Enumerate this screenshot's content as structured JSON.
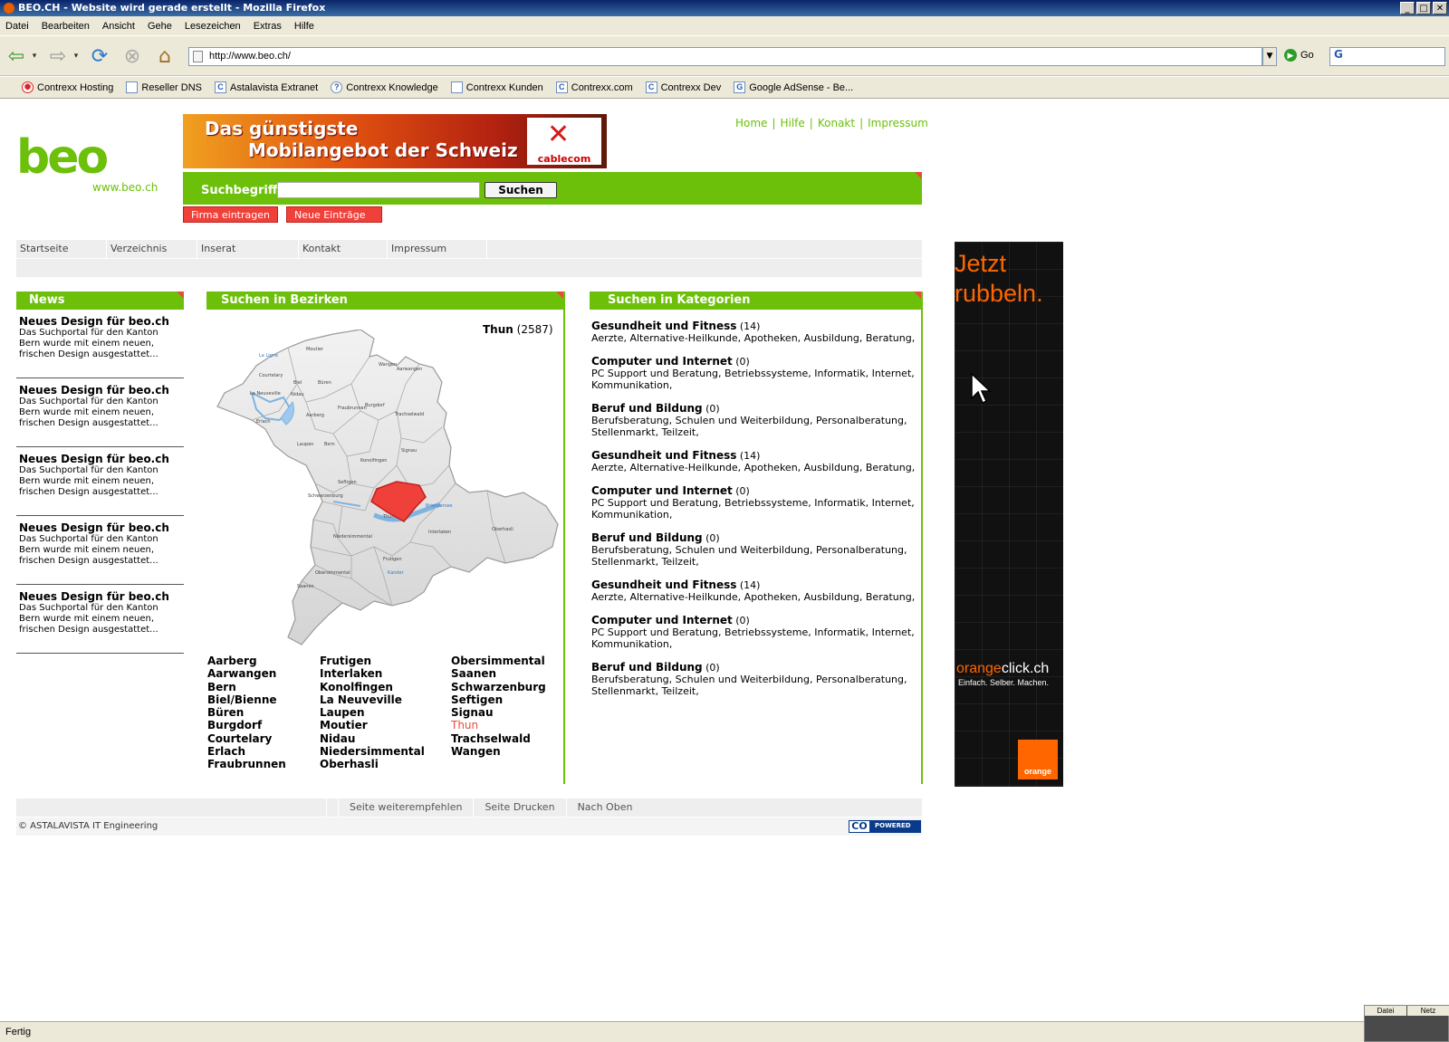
{
  "window": {
    "title": "BEO.CH - Website wird gerade erstellt - Mozilla Firefox"
  },
  "menu": [
    "Datei",
    "Bearbeiten",
    "Ansicht",
    "Gehe",
    "Lesezeichen",
    "Extras",
    "Hilfe"
  ],
  "urlbar": {
    "url": "http://www.beo.ch/",
    "go_label": "Go"
  },
  "bookmarks": [
    "Contrexx Hosting",
    "Reseller DNS",
    "Astalavista Extranet",
    "Contrexx Knowledge",
    "Contrexx Kunden",
    "Contrexx.com",
    "Contrexx Dev",
    "Google AdSense - Be..."
  ],
  "site": {
    "logo_word": "beo",
    "logo_url": "www.beo.ch",
    "top_links": [
      "Home",
      "Hilfe",
      "Konakt",
      "Impressum"
    ],
    "banner": {
      "line1": "Das günstigste",
      "line2": "Mobilangebot der Schweiz",
      "brand": "cablecom"
    },
    "search": {
      "label": "Suchbegriff",
      "button": "Suchen",
      "value": ""
    },
    "action_buttons": [
      "Firma eintragen",
      "Neue Einträge"
    ],
    "nav": [
      "Startseite",
      "Verzeichnis",
      "Inserat",
      "Kontakt",
      "Impressum"
    ]
  },
  "news": {
    "title": "News",
    "items": [
      {
        "title": "Neues Design für beo.ch",
        "text": "Das Suchportal für den Kanton Bern wurde mit einem neuen, frischen Design ausgestattet..."
      },
      {
        "title": "Neues Design für beo.ch",
        "text": "Das Suchportal für den Kanton Bern wurde mit einem neuen, frischen Design ausgestattet..."
      },
      {
        "title": "Neues Design für beo.ch",
        "text": "Das Suchportal für den Kanton Bern wurde mit einem neuen, frischen Design ausgestattet..."
      },
      {
        "title": "Neues Design für beo.ch",
        "text": "Das Suchportal für den Kanton Bern wurde mit einem neuen, frischen Design ausgestattet..."
      },
      {
        "title": "Neues Design für beo.ch",
        "text": "Das Suchportal für den Kanton Bern wurde mit einem neuen, frischen Design ausgestattet..."
      }
    ]
  },
  "bezirke": {
    "title": "Suchen in Bezirken",
    "selected_name": "Thun",
    "selected_count": "(2587)",
    "col1": [
      "Aarberg",
      "Aarwangen",
      "Bern",
      "Biel/Bienne",
      "Büren",
      "Burgdorf",
      "Courtelary",
      "Erlach",
      "Fraubrunnen"
    ],
    "col2": [
      "Frutigen",
      "Interlaken",
      "Konolfingen",
      "La Neuveville",
      "Laupen",
      "Moutier",
      "Nidau",
      "Niedersimmental",
      "Oberhasli"
    ],
    "col3": [
      "Obersimmental",
      "Saanen",
      "Schwarzenburg",
      "Seftigen",
      "Signau",
      "Thun",
      "Trachselwald",
      "Wangen"
    ],
    "highlight": "Thun",
    "map_labels": [
      "Moutier",
      "La Ligne",
      "Courtelary",
      "Biel",
      "La Neuveville",
      "Nidau",
      "Büren",
      "Aarwangen",
      "Wangen",
      "Burgdorf",
      "Erlach",
      "Aarberg",
      "Fraubrunnen",
      "Trachselwald",
      "Laupen",
      "Bern",
      "Konolfingen",
      "Signau",
      "Seftigen",
      "Schwarzenburg",
      "Thun",
      "Brienzersee",
      "Oberhasli",
      "Niedersimmental",
      "Interlaken",
      "Obersimmental",
      "Frutigen",
      "Saanen",
      "Kander"
    ]
  },
  "kategorien": {
    "title": "Suchen in Kategorien",
    "items": [
      {
        "name": "Gesundheit und Fitness",
        "count": "(14)",
        "sub": "Aerzte, Alternative-Heilkunde, Apotheken, Ausbildung, Beratung,"
      },
      {
        "name": "Computer und Internet",
        "count": "(0)",
        "sub": "PC Support und Beratung, Betriebssysteme, Informatik, Internet, Kommunikation,"
      },
      {
        "name": "Beruf und Bildung",
        "count": "(0)",
        "sub": "Berufsberatung, Schulen und Weiterbildung, Personalberatung, Stellenmarkt, Teilzeit,"
      },
      {
        "name": "Gesundheit und Fitness",
        "count": "(14)",
        "sub": "Aerzte, Alternative-Heilkunde, Apotheken, Ausbildung, Beratung,"
      },
      {
        "name": "Computer und Internet",
        "count": "(0)",
        "sub": "PC Support und Beratung, Betriebssysteme, Informatik, Internet, Kommunikation,"
      },
      {
        "name": "Beruf und Bildung",
        "count": "(0)",
        "sub": "Berufsberatung, Schulen und Weiterbildung, Personalberatung, Stellenmarkt, Teilzeit,"
      },
      {
        "name": "Gesundheit und Fitness",
        "count": "(14)",
        "sub": "Aerzte, Alternative-Heilkunde, Apotheken, Ausbildung, Beratung,"
      },
      {
        "name": "Computer und Internet",
        "count": "(0)",
        "sub": "PC Support und Beratung, Betriebssysteme, Informatik, Internet, Kommunikation,"
      },
      {
        "name": "Beruf und Bildung",
        "count": "(0)",
        "sub": "Berufsberatung, Schulen und Weiterbildung, Personalberatung, Stellenmarkt, Teilzeit,"
      }
    ]
  },
  "footer": {
    "links": [
      "Seite weiterempfehlen",
      "Seite Drucken",
      "Nach Oben"
    ],
    "copyright": "© ASTALAVISTA IT Engineering",
    "badge_co": "CO",
    "badge_text": "POWERED"
  },
  "skyscraper_ad": {
    "headline1": "Jetzt",
    "headline2": "rubbeln.",
    "brand_orange": "orange",
    "brand_click": "click.ch",
    "slogan": "Einfach. Selber. Machen.",
    "logo": "orange"
  },
  "status": {
    "text": "Fertig",
    "widget_labels": [
      "Datei",
      "Netz"
    ]
  },
  "colors": {
    "brand_green": "#6cc00a",
    "accent_red": "#e84b3c",
    "highlight_red": "#e84b3c"
  }
}
